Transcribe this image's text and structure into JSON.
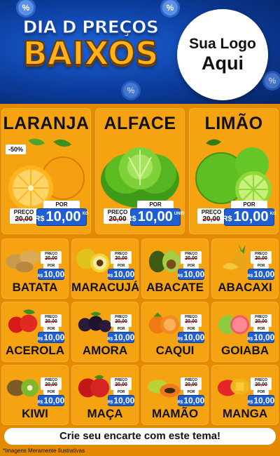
{
  "header": {
    "title_top": "DIA D PREÇOS",
    "title_bottom": "BAIXOS",
    "badge_symbol": "%",
    "logo_line1": "Sua Logo",
    "logo_line2": "Aqui"
  },
  "labels": {
    "preco": "PREÇO",
    "por": "POR",
    "currency": "R$"
  },
  "featured": [
    {
      "name": "LARANJA",
      "old_price": "20,00",
      "price": "10,00",
      "unit": "KG",
      "discount": "-50%"
    },
    {
      "name": "ALFACE",
      "old_price": "20,00",
      "price": "10,00",
      "unit": "UNID"
    },
    {
      "name": "LIMÃO",
      "old_price": "20,00",
      "price": "10,00",
      "unit": "KG"
    }
  ],
  "products": [
    {
      "name": "BATATA",
      "old_price": "20,00",
      "price": "10,00"
    },
    {
      "name": "MARACUJÁ",
      "old_price": "20,00",
      "price": "10,00"
    },
    {
      "name": "ABACATE",
      "old_price": "20,00",
      "price": "10,00"
    },
    {
      "name": "ABACAXI",
      "old_price": "20,00",
      "price": "10,00"
    },
    {
      "name": "ACEROLA",
      "old_price": "20,00",
      "price": "10,00"
    },
    {
      "name": "AMORA",
      "old_price": "20,00",
      "price": "10,00"
    },
    {
      "name": "CAQUI",
      "old_price": "20,00",
      "price": "10,00"
    },
    {
      "name": "GOIABA",
      "old_price": "20,00",
      "price": "10,00"
    },
    {
      "name": "KIWI",
      "old_price": "20,00",
      "price": "10,00"
    },
    {
      "name": "MAÇA",
      "old_price": "20,00",
      "price": "10,00"
    },
    {
      "name": "MAMÃO",
      "old_price": "20,00",
      "price": "10,00"
    },
    {
      "name": "MANGA",
      "old_price": "20,00",
      "price": "10,00"
    }
  ],
  "cta_text": "Crie seu encarte com este tema!",
  "disclaimer": "*Imagens Meramente Ilustrativas",
  "colors": {
    "header_blue": "#0b3c9c",
    "board_orange": "#e38a00",
    "card_orange": "#f6a312",
    "price_blue": "#1f5fd6",
    "title_gold": "#ffb21a"
  }
}
